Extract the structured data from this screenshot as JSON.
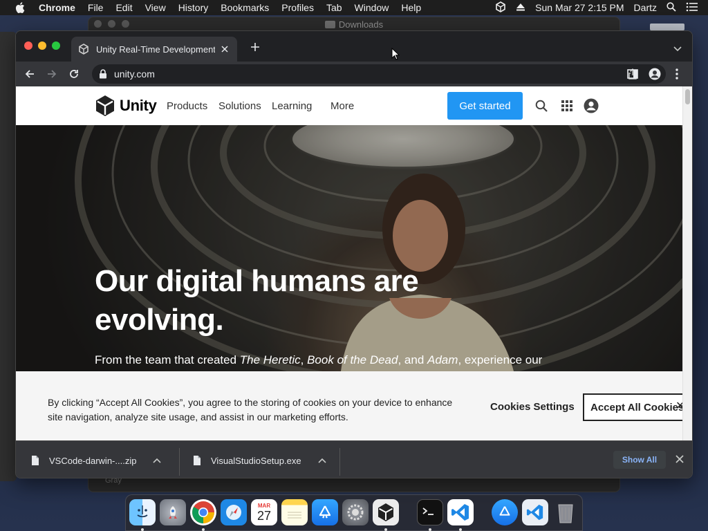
{
  "menubar": {
    "app": "Chrome",
    "items": [
      "File",
      "Edit",
      "View",
      "History",
      "Bookmarks",
      "Profiles",
      "Tab",
      "Window",
      "Help"
    ],
    "datetime": "Sun Mar 27  2:15 PM",
    "user": "Dartz"
  },
  "background_window": {
    "title": "Downloads",
    "bottom_label": "Gray"
  },
  "browser": {
    "tab_title": "Unity Real-Time Development",
    "url": "unity.com"
  },
  "site": {
    "logo_text": "Unity",
    "nav": [
      "Products",
      "Solutions",
      "Learning",
      "More"
    ],
    "cta": "Get started",
    "hero": {
      "headline_line1": "Our digital humans are",
      "headline_line2": "evolving.",
      "sub_prefix": "From the team that created ",
      "sub_title1": "The Heretic",
      "sub_sep1": ", ",
      "sub_title2": "Book of the Dead",
      "sub_sep2": ", and ",
      "sub_title3": "Adam",
      "sub_suffix": ", experience our"
    },
    "cookie": {
      "text": "By clicking “Accept All Cookies”, you agree to the storing of cookies on your device to enhance site navigation, analyze site usage, and assist in our marketing efforts.",
      "settings_label": "Cookies Settings",
      "accept_label": "Accept All Cookies",
      "close_glyph": "✕"
    }
  },
  "downloads": {
    "items": [
      "VSCode-darwin-....zip",
      "VisualStudioSetup.exe"
    ],
    "show_all": "Show All"
  },
  "dock": {
    "calendar_month": "MAR",
    "calendar_day": "27",
    "icons": [
      "finder-icon",
      "launchpad-icon",
      "chrome-icon",
      "safari-icon",
      "calendar-icon",
      "notes-icon",
      "app-store-icon",
      "system-preferences-icon",
      "unity-hub-icon",
      "terminal-icon",
      "vscode-icon",
      "app-store-download-icon",
      "vscode-download-icon",
      "trash-icon"
    ]
  },
  "colors": {
    "accent": "#2196f3",
    "chrome_dark": "#202124",
    "toolbar": "#35363a",
    "link_blue": "#8ab4f8"
  }
}
